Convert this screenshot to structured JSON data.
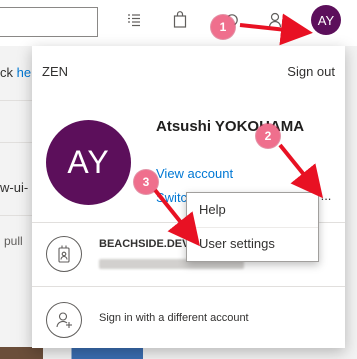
{
  "background": {
    "left_text_1": "ck",
    "left_link_1": "he",
    "left_text_2": "w-ui-",
    "left_text_3": "pull"
  },
  "header": {
    "avatar_initials": "AY"
  },
  "account_panel": {
    "org_name": "ZEN",
    "sign_out_label": "Sign out",
    "avatar_initials": "AY",
    "user_name": "Atsushi YOKOHAMA",
    "view_account_label": "View account",
    "switch_label": "Switch",
    "more_label": "...",
    "other_account_name": "BEACHSIDE.DEV",
    "add_account_label": "Sign in with a different account"
  },
  "context_menu": {
    "items": [
      {
        "label": "Help"
      },
      {
        "label": "User settings"
      }
    ]
  },
  "callouts": [
    {
      "number": "1"
    },
    {
      "number": "2"
    },
    {
      "number": "3"
    }
  ],
  "colors": {
    "accent": "#0078d4",
    "avatar": "#5c0f5b",
    "callout": "#ef6f8d",
    "arrow": "#e81123"
  }
}
